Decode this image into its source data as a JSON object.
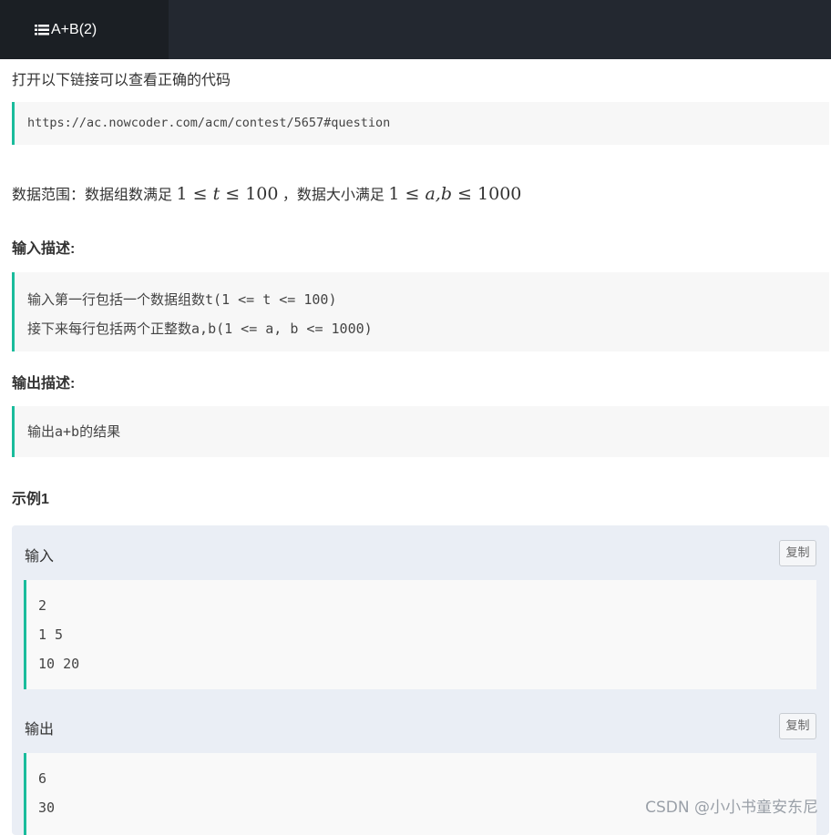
{
  "tab": {
    "title": "A+B(2)",
    "icon": "list-icon"
  },
  "intro_text": "打开以下链接可以查看正确的代码",
  "url": "https://ac.nowcoder.com/acm/contest/5657#question",
  "range": {
    "prefix": "数据范围：数据组数满足",
    "t_lower": "1",
    "t_var": "t",
    "t_upper": "100",
    "middle": "，数据大小满足",
    "ab_lower": "1",
    "ab_var": "a,b",
    "ab_upper": "1000"
  },
  "input_heading": "输入描述:",
  "input_lines": [
    "输入第一行包括一个数据组数t(1 <= t <= 100)",
    "接下来每行包括两个正整数a,b(1 <= a, b <= 1000)"
  ],
  "output_heading": "输出描述:",
  "output_text": "输出a+b的结果",
  "example": {
    "heading": "示例1",
    "input_label": "输入",
    "input_lines": [
      "2",
      "1 5",
      "10 20"
    ],
    "output_label": "输出",
    "output_lines": [
      "6",
      "30"
    ],
    "copy_label": "复制"
  },
  "watermark": "CSDN @小小书童安东尼",
  "colors": {
    "accent": "#1abc9c",
    "topbar": "#232830"
  }
}
